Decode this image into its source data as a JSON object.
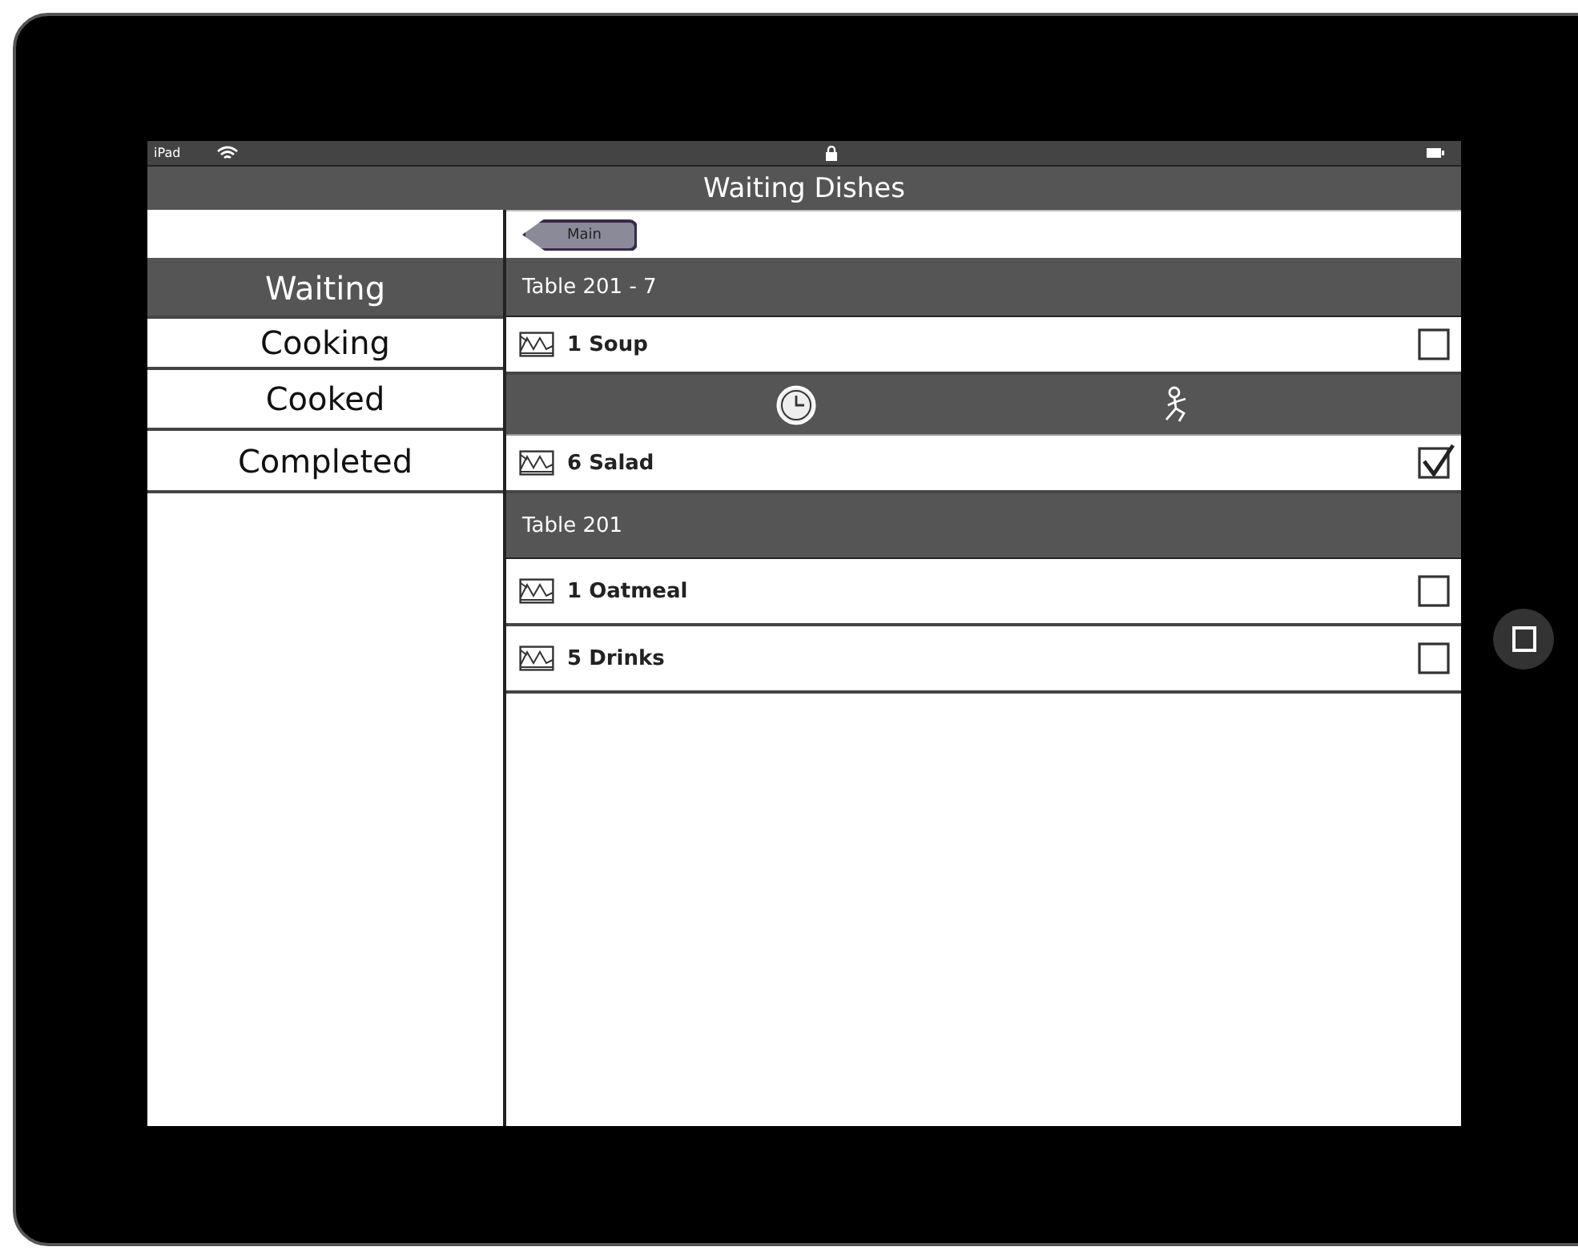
{
  "status_bar": {
    "carrier": "iPad"
  },
  "nav_bar": {
    "title": "Waiting Dishes",
    "back_button": "Main"
  },
  "sidebar": {
    "items": [
      {
        "label": "Waiting",
        "selected": true
      },
      {
        "label": "Cooking",
        "selected": false
      },
      {
        "label": "Cooked",
        "selected": false
      },
      {
        "label": "Completed",
        "selected": false
      }
    ]
  },
  "list": [
    {
      "kind": "header",
      "label": "Table 201 - 7"
    },
    {
      "kind": "item",
      "label": "1 Soup",
      "checked": false
    },
    {
      "kind": "actions"
    },
    {
      "kind": "item",
      "label": "6 Salad",
      "checked": true
    },
    {
      "kind": "header",
      "label": "Table 201"
    },
    {
      "kind": "item",
      "label": "1 Oatmeal",
      "checked": false
    },
    {
      "kind": "item",
      "label": "5 Drinks",
      "checked": false
    }
  ]
}
